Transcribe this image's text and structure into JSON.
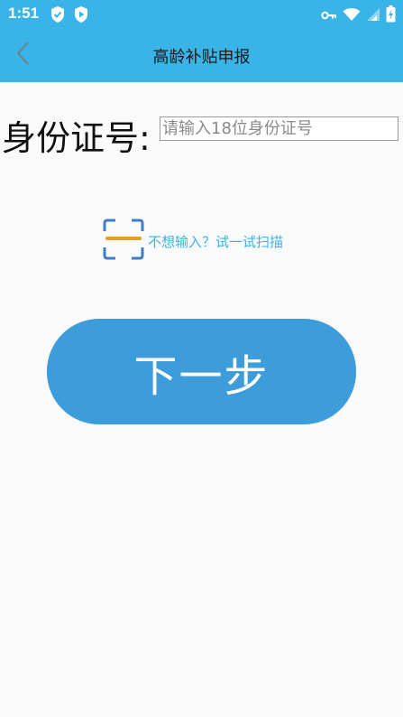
{
  "status_bar": {
    "time": "1:51",
    "left_icons": [
      "shield-check-icon",
      "play-shield-icon"
    ],
    "right_icons": [
      "key-icon",
      "wifi-icon",
      "signal-icon",
      "battery-charging-icon"
    ]
  },
  "app_bar": {
    "title": "高龄补贴申报",
    "back_icon": "chevron-left-icon"
  },
  "form": {
    "id_label": "身份证号:",
    "id_input_value": "",
    "id_input_placeholder": "请输入18位身份证号"
  },
  "scan": {
    "icon": "scan-frame-icon",
    "text": "不想输入？试一试扫描"
  },
  "next_button": {
    "label": "下一步"
  },
  "colors": {
    "primary": "#3ab4e6",
    "button": "#3d9cda",
    "scan_frame": "#3f7ec2",
    "scan_line": "#e0a020"
  }
}
